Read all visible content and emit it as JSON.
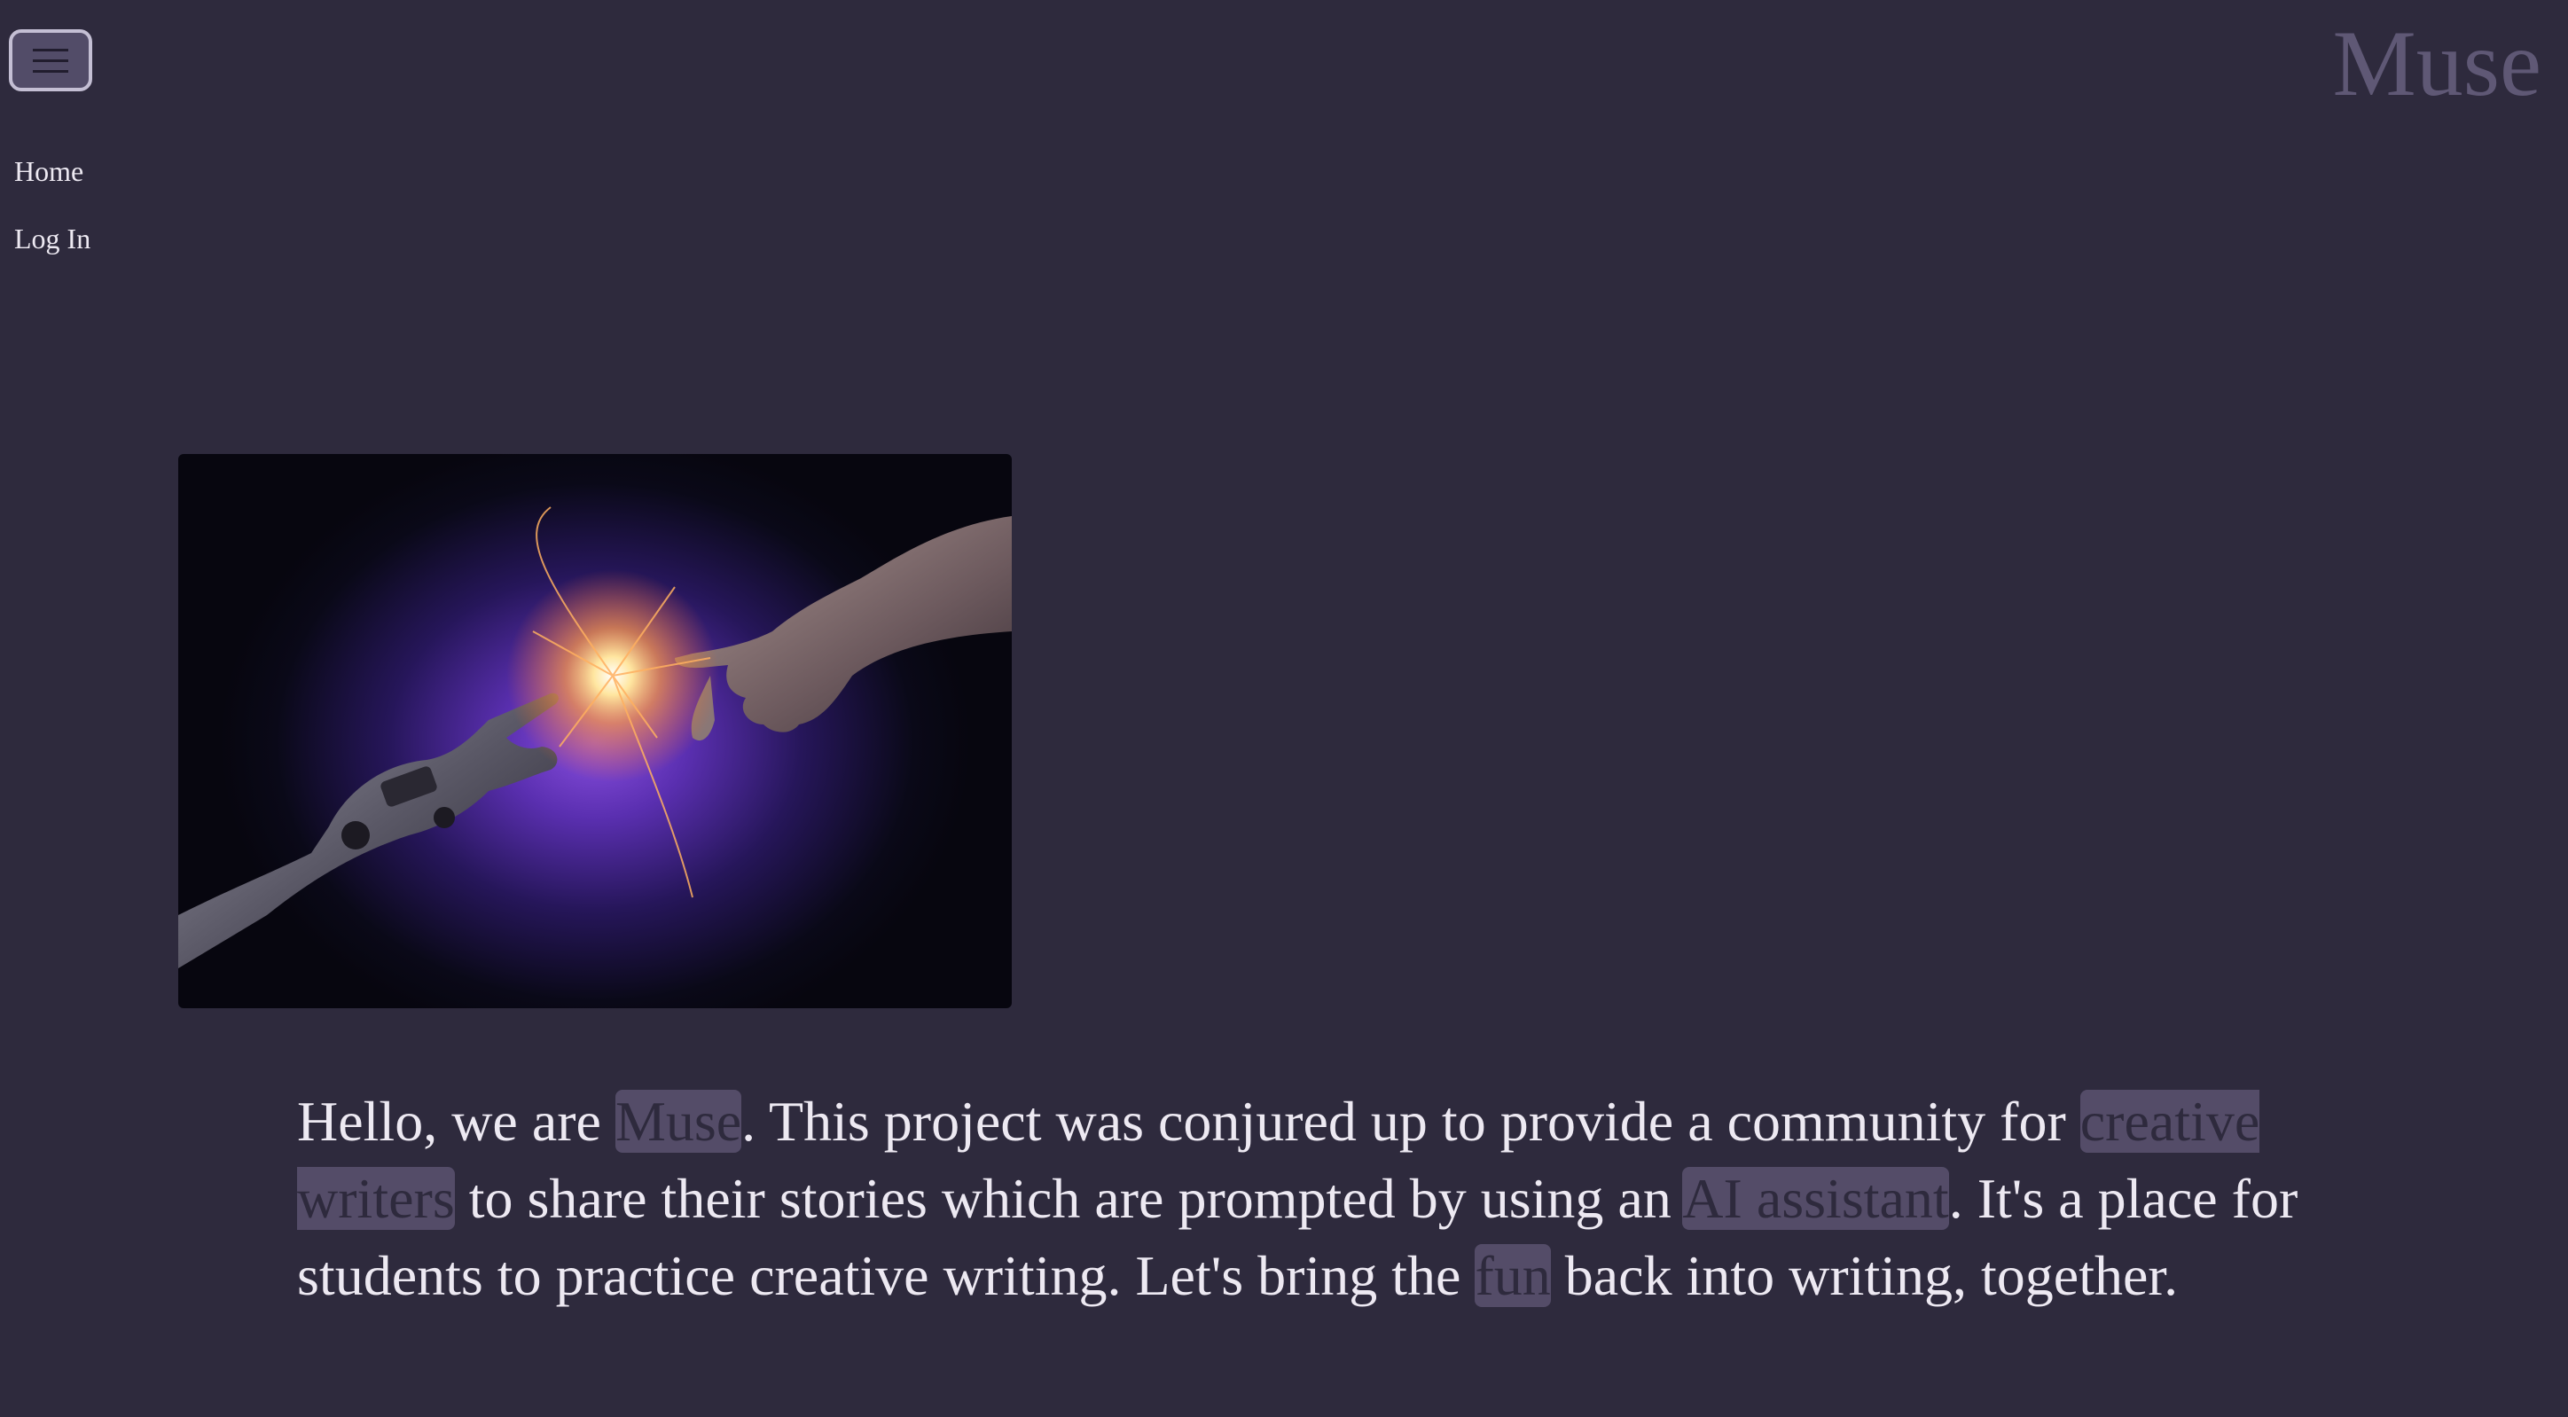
{
  "header": {
    "brand": "Muse",
    "menu_icon": "hamburger-icon"
  },
  "nav": {
    "items": [
      {
        "label": "Home"
      },
      {
        "label": "Log In"
      }
    ]
  },
  "hero": {
    "image_subject": "robot-hand-and-human-hand-sparks"
  },
  "intro": {
    "part1": "Hello, we are ",
    "hl1": "Muse",
    "part2": ". This project was conjured up to provide a community for ",
    "hl2": "creative writers",
    "part3": " to share their stories which are prompted by using an ",
    "hl3": "AI assistant",
    "part4": ". It's a place for students to practice creative writing. Let's bring the ",
    "hl4": "fun",
    "part5": " back into writing, together."
  },
  "colors": {
    "background": "#2e2a3d",
    "highlight": "#544c68",
    "brand": "#5f5875",
    "text": "#ede9f2"
  }
}
